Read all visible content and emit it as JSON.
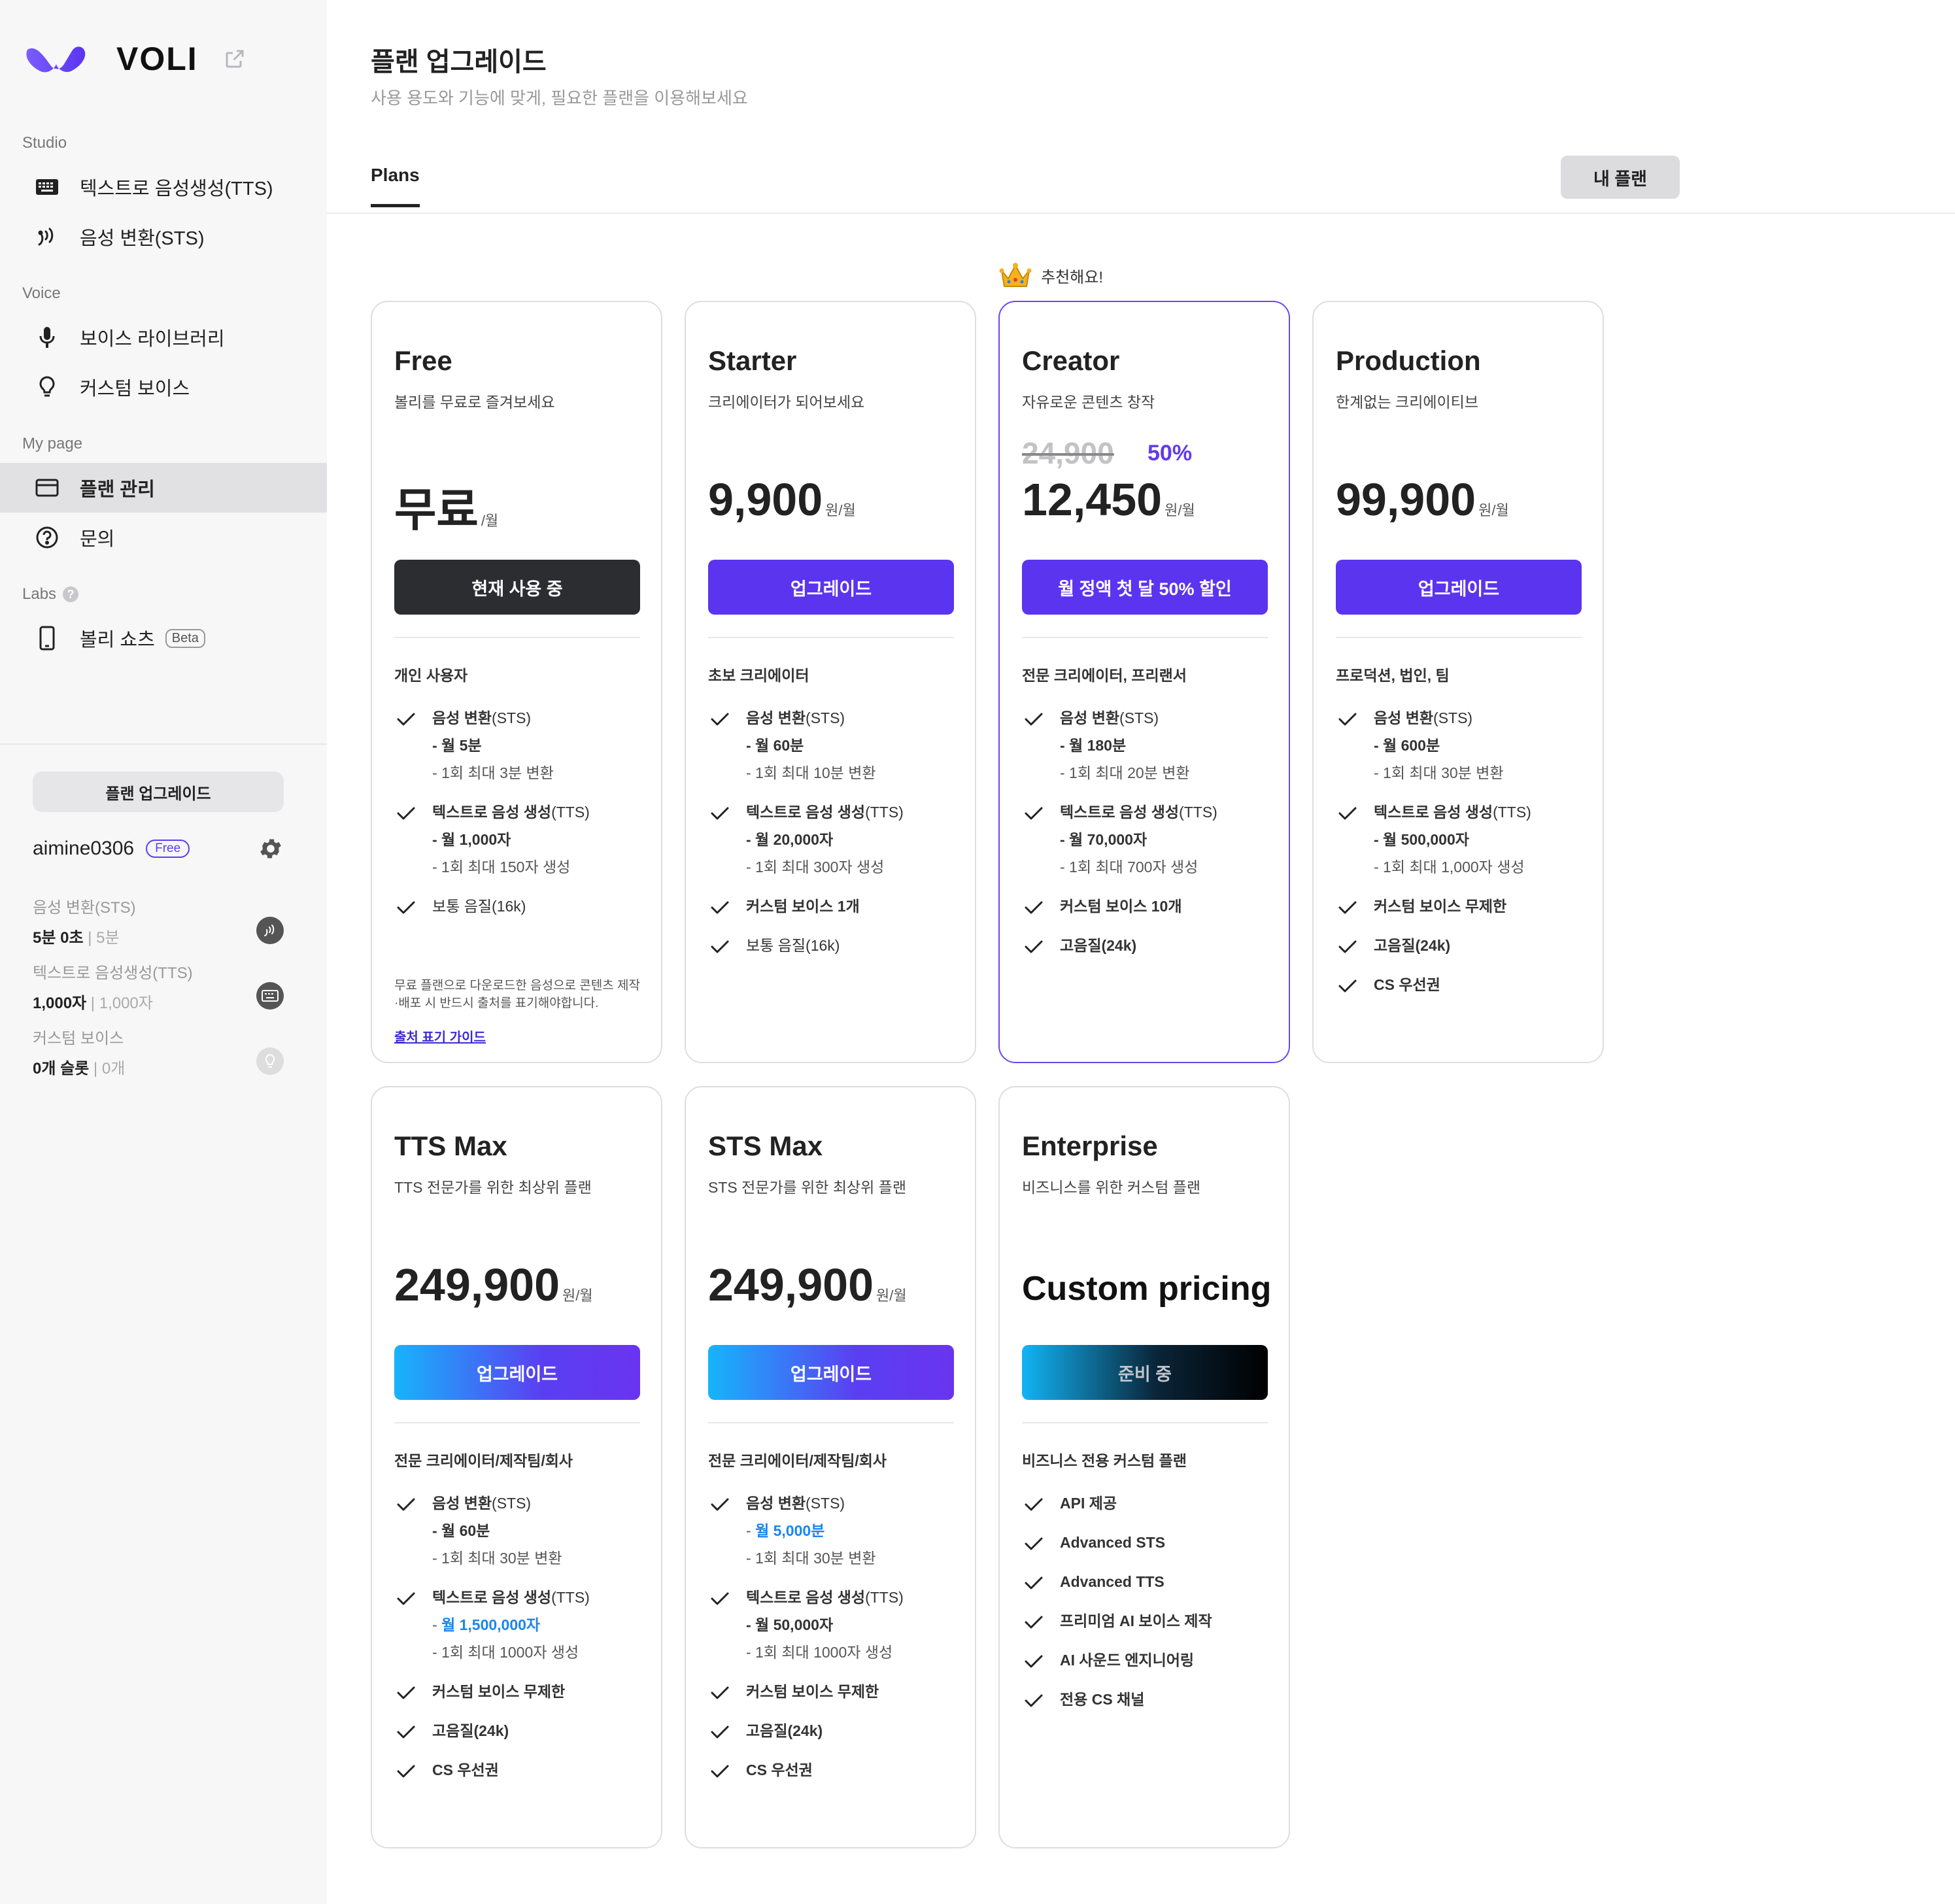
{
  "brand": {
    "name": "VOLI"
  },
  "sidebar": {
    "sections": [
      {
        "title": "Studio"
      },
      {
        "title": "Voice"
      },
      {
        "title": "My page"
      },
      {
        "title": "Labs"
      }
    ],
    "items": [
      {
        "label": "텍스트로 음성생성(TTS)",
        "icon": "keyboard-icon"
      },
      {
        "label": "음성 변환(STS)",
        "icon": "voice-convert-icon"
      },
      {
        "label": "보이스 라이브러리",
        "icon": "microphone-icon"
      },
      {
        "label": "커스텀 보이스",
        "icon": "lightbulb-icon"
      },
      {
        "label": "플랜 관리",
        "icon": "card-icon",
        "active": true
      },
      {
        "label": "문의",
        "icon": "help-icon"
      },
      {
        "label": "볼리 쇼츠",
        "icon": "phone-icon",
        "badge": "Beta"
      }
    ],
    "upgrade_label": "플랜 업그레이드",
    "user": {
      "name": "aimine0306",
      "plan_badge": "Free"
    },
    "usage": [
      {
        "label": "음성 변환(STS)",
        "value": "5분 0초",
        "max": "5분"
      },
      {
        "label": "텍스트로 음성생성(TTS)",
        "value": "1,000자",
        "max": "1,000자"
      },
      {
        "label": "커스텀 보이스",
        "value": "0개 슬롯",
        "max": "0개"
      }
    ]
  },
  "header": {
    "title": "플랜 업그레이드",
    "subtitle": "사용 용도와 기능에 맞게, 필요한 플랜을 이용해보세요",
    "tab": "Plans",
    "my_plan_label": "내 플랜"
  },
  "recommend_label": "추천해요!",
  "colors": {
    "accent": "#5b34f0",
    "featured_border": "#6b48ee",
    "discount": "#6239ee",
    "highlight": "#1a86ee"
  },
  "plans": [
    {
      "name": "Free",
      "desc": "볼리를 무료로 즐겨보세요",
      "price": "무료",
      "unit": "/월",
      "button": "현재 사용 중",
      "target": "개인 사용자",
      "features": [
        {
          "text": "음성 변환",
          "suffix": "(STS)",
          "subs": [
            {
              "t": "- 월 5분",
              "s": "b"
            },
            {
              "t": "- 1회 최대 3분 변환",
              "s": ""
            }
          ]
        },
        {
          "text": "텍스트로 음성 생성",
          "suffix": "(TTS)",
          "subs": [
            {
              "t": "- 월 1,000자",
              "s": "b"
            },
            {
              "t": "- 1회 최대 150자 생성",
              "s": ""
            }
          ]
        },
        {
          "text": "보통 음질(16k)",
          "suffix": "",
          "plain": true,
          "subs": []
        }
      ],
      "notice": "무료 플랜으로 다운로드한 음성으로 콘텐츠 제작·배포 시 반드시 출처를 표기해야합니다.",
      "notice_link": "출처 표기 가이드"
    },
    {
      "name": "Starter",
      "desc": "크리에이터가 되어보세요",
      "price": "9,900",
      "unit": "원/월",
      "button": "업그레이드",
      "target": "초보 크리에이터",
      "features": [
        {
          "text": "음성 변환",
          "suffix": "(STS)",
          "subs": [
            {
              "t": "- 월 60분",
              "s": "b"
            },
            {
              "t": "- 1회 최대 10분 변환",
              "s": ""
            }
          ]
        },
        {
          "text": "텍스트로 음성 생성",
          "suffix": "(TTS)",
          "subs": [
            {
              "t": "- 월 20,000자",
              "s": "b"
            },
            {
              "t": "- 1회 최대 300자 생성",
              "s": ""
            }
          ]
        },
        {
          "text": "커스텀 보이스 1개",
          "suffix": "",
          "subs": []
        },
        {
          "text": "보통 음질(16k)",
          "suffix": "",
          "plain": true,
          "subs": []
        }
      ]
    },
    {
      "name": "Creator",
      "desc": "자유로운 콘텐츠 창작",
      "original_price": "24,900",
      "discount": "50%",
      "price": "12,450",
      "unit": "원/월",
      "button": "월 정액 첫 달 50% 할인",
      "target": "전문 크리에이터, 프리랜서",
      "features": [
        {
          "text": "음성 변환",
          "suffix": "(STS)",
          "subs": [
            {
              "t": "- 월 180분",
              "s": "b"
            },
            {
              "t": "- 1회 최대 20분 변환",
              "s": ""
            }
          ]
        },
        {
          "text": "텍스트로 음성 생성",
          "suffix": "(TTS)",
          "subs": [
            {
              "t": "- 월 70,000자",
              "s": "b"
            },
            {
              "t": "- 1회 최대 700자 생성",
              "s": ""
            }
          ]
        },
        {
          "text": "커스텀 보이스 10개",
          "suffix": "",
          "subs": []
        },
        {
          "text": "고음질(24k)",
          "suffix": "",
          "subs": []
        }
      ]
    },
    {
      "name": "Production",
      "desc": "한계없는 크리에이티브",
      "price": "99,900",
      "unit": "원/월",
      "button": "업그레이드",
      "target": "프로덕션, 법인, 팀",
      "features": [
        {
          "text": "음성 변환",
          "suffix": "(STS)",
          "subs": [
            {
              "t": "- 월 600분",
              "s": "b"
            },
            {
              "t": "- 1회 최대 30분 변환",
              "s": ""
            }
          ]
        },
        {
          "text": "텍스트로 음성 생성",
          "suffix": "(TTS)",
          "subs": [
            {
              "t": "- 월 500,000자",
              "s": "b"
            },
            {
              "t": "- 1회 최대 1,000자 생성",
              "s": ""
            }
          ]
        },
        {
          "text": "커스텀 보이스 무제한",
          "suffix": "",
          "subs": []
        },
        {
          "text": "고음질(24k)",
          "suffix": "",
          "subs": []
        },
        {
          "text": "CS 우선권",
          "suffix": "",
          "subs": []
        }
      ]
    },
    {
      "name": "TTS Max",
      "desc": "TTS 전문가를 위한 최상위 플랜",
      "price": "249,900",
      "unit": "원/월",
      "button": "업그레이드",
      "target": "전문 크리에이터/제작팀/회사",
      "features": [
        {
          "text": "음성 변환",
          "suffix": "(STS)",
          "subs": [
            {
              "t": "- 월 60분",
              "s": "b"
            },
            {
              "t": "- 1회 최대 30분 변환",
              "s": ""
            }
          ]
        },
        {
          "text": "텍스트로 음성 생성",
          "suffix": "(TTS)",
          "subs": [
            {
              "t": "- ",
              "t2": "월 1,500,000자",
              "s": "hl"
            },
            {
              "t": "- 1회 최대 1000자 생성",
              "s": ""
            }
          ]
        },
        {
          "text": "커스텀 보이스 무제한",
          "suffix": "",
          "subs": []
        },
        {
          "text": "고음질(24k)",
          "suffix": "",
          "subs": []
        },
        {
          "text": "CS 우선권",
          "suffix": "",
          "subs": []
        }
      ]
    },
    {
      "name": "STS Max",
      "desc": "STS 전문가를 위한 최상위 플랜",
      "price": "249,900",
      "unit": "원/월",
      "button": "업그레이드",
      "target": "전문 크리에이터/제작팀/회사",
      "features": [
        {
          "text": "음성 변환",
          "suffix": "(STS)",
          "subs": [
            {
              "t": "- ",
              "t2": "월 5,000분",
              "s": "hl"
            },
            {
              "t": "- 1회 최대 30분 변환",
              "s": ""
            }
          ]
        },
        {
          "text": "텍스트로 음성 생성",
          "suffix": "(TTS)",
          "subs": [
            {
              "t": "- 월 50,000자",
              "s": "b"
            },
            {
              "t": "- 1회 최대 1000자 생성",
              "s": ""
            }
          ]
        },
        {
          "text": "커스텀 보이스 무제한",
          "suffix": "",
          "subs": []
        },
        {
          "text": "고음질(24k)",
          "suffix": "",
          "subs": []
        },
        {
          "text": "CS 우선권",
          "suffix": "",
          "subs": []
        }
      ]
    },
    {
      "name": "Enterprise",
      "desc": "비즈니스를 위한 커스텀 플랜",
      "custom_price": "Custom pricing",
      "button": "준비 중",
      "target": "비즈니스 전용 커스텀 플랜",
      "features": [
        {
          "text": "API 제공",
          "suffix": "",
          "subs": []
        },
        {
          "text": "Advanced STS",
          "suffix": "",
          "subs": []
        },
        {
          "text": "Advanced TTS",
          "suffix": "",
          "subs": []
        },
        {
          "text": "프리미엄 AI 보이스 제작",
          "suffix": "",
          "subs": []
        },
        {
          "text": "AI 사운드 엔지니어링",
          "suffix": "",
          "subs": []
        },
        {
          "text": "전용 CS 채널",
          "suffix": "",
          "subs": []
        }
      ]
    }
  ]
}
